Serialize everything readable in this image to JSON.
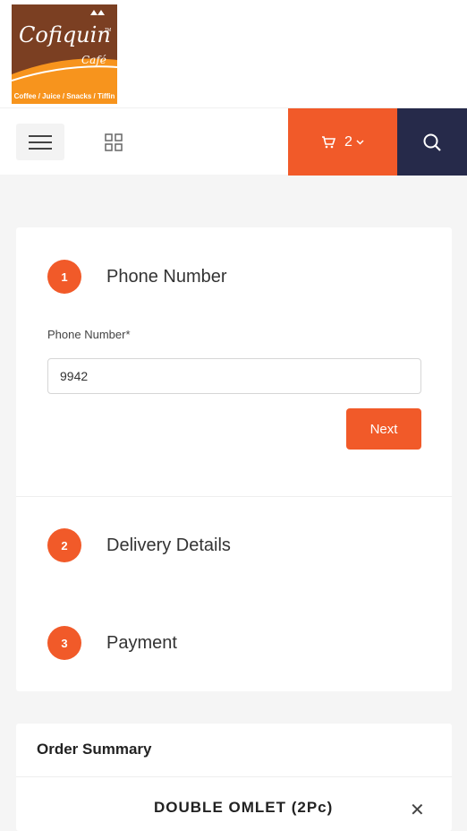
{
  "brand": {
    "logo_text": "Cofiquin",
    "logo_subtext": "Café",
    "logo_tm": "TM",
    "tagline": "Coffee / Juice / Snacks / Tiffin",
    "colors": {
      "brown": "#7b3f22",
      "orange": "#f15a29",
      "navy": "#262a4a"
    }
  },
  "navbar": {
    "menu_icon": "hamburger-icon",
    "grid_icon": "grid-icon",
    "cart_icon": "cart-icon",
    "cart_count": "2",
    "cart_chevron_icon": "chevron-down-icon",
    "search_icon": "search-icon"
  },
  "checkout": {
    "steps": [
      {
        "number": "1",
        "title": "Phone Number"
      },
      {
        "number": "2",
        "title": "Delivery Details"
      },
      {
        "number": "3",
        "title": "Payment"
      }
    ],
    "phone_label": "Phone Number*",
    "phone_value": "9942",
    "next_label": "Next"
  },
  "order_summary": {
    "title": "Order Summary",
    "item_partial": "DOUBLE OMLET (2Pc)",
    "remove_icon": "close-icon"
  }
}
